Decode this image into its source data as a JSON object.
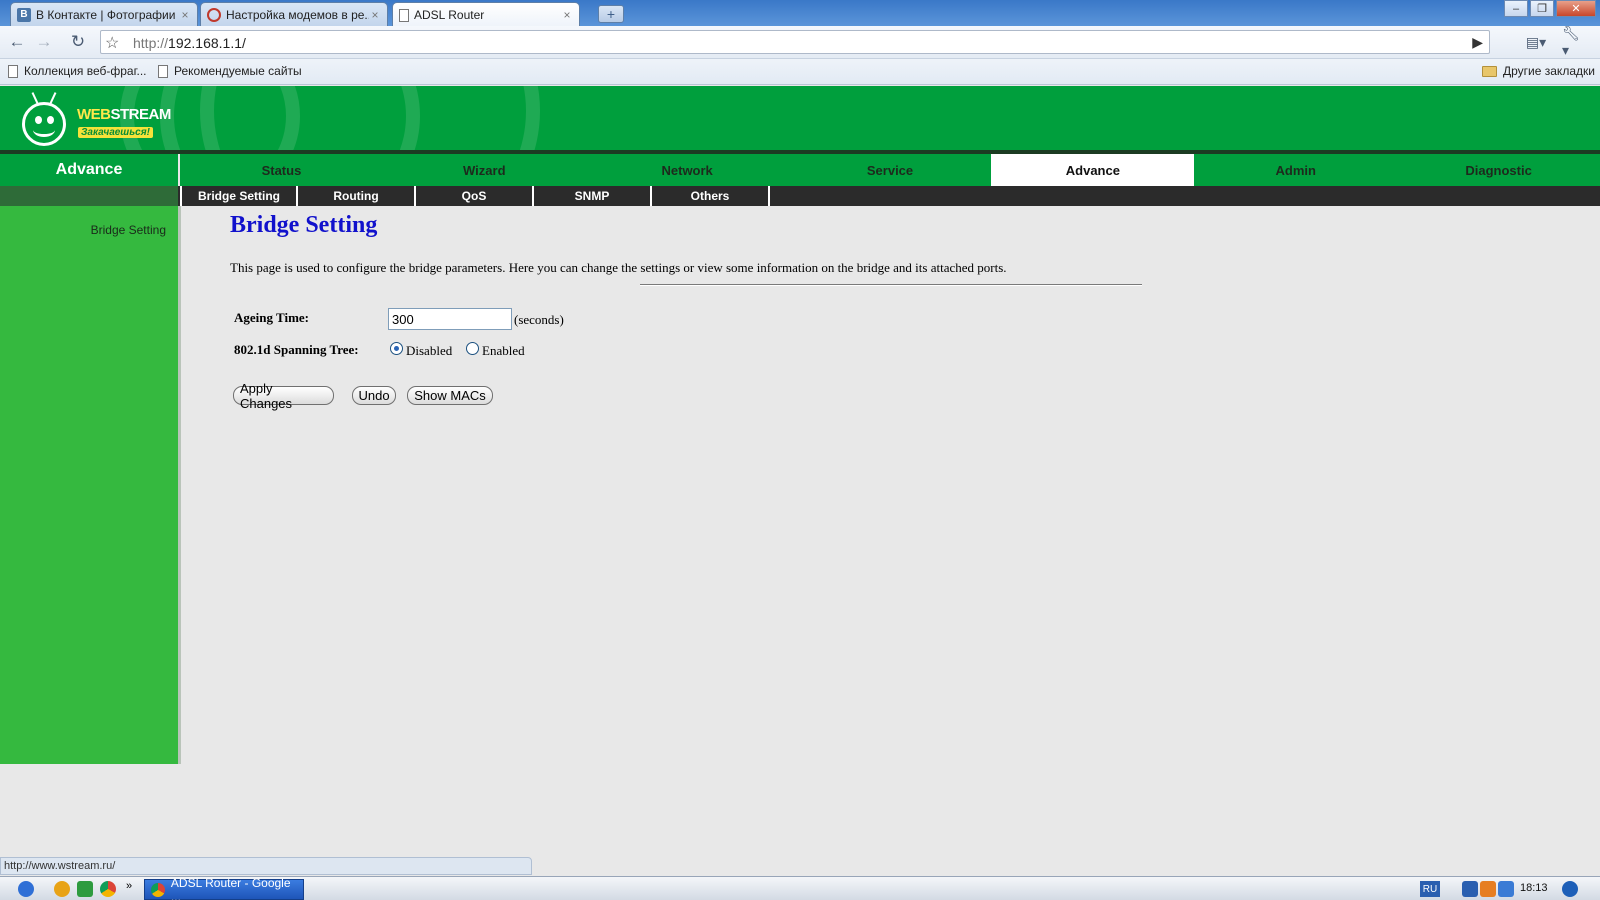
{
  "browser": {
    "tabs": [
      {
        "label": "В Контакте | Фотографии",
        "icon": "vk-icon",
        "active": false
      },
      {
        "label": "Настройка модемов в ре...",
        "icon": "site-favicon",
        "active": false
      },
      {
        "label": "ADSL Router",
        "icon": "page-icon",
        "active": true
      }
    ],
    "close_glyph": "×",
    "new_tab_glyph": "+",
    "address": {
      "scheme": "http://",
      "host": "192.168.1.1/"
    },
    "bookmarks": [
      "Коллекция веб-фраг...",
      "Рекомендуемые сайты"
    ],
    "other_bookmarks": "Другие закладки"
  },
  "router": {
    "brand": {
      "web": "WEB",
      "stream": "STREAM",
      "slogan": "Закачаешься!"
    },
    "section_title": "Advance",
    "main_nav": [
      {
        "label": "Status",
        "active": false
      },
      {
        "label": "Wizard",
        "active": false
      },
      {
        "label": "Network",
        "active": false
      },
      {
        "label": "Service",
        "active": false
      },
      {
        "label": "Advance",
        "active": true
      },
      {
        "label": "Admin",
        "active": false
      },
      {
        "label": "Diagnostic",
        "active": false
      }
    ],
    "sub_nav": [
      "Bridge Setting",
      "Routing",
      "QoS",
      "SNMP",
      "Others"
    ],
    "sidebar_link": "Bridge Setting",
    "page": {
      "title": "Bridge Setting",
      "description": "This page is used to configure the bridge parameters. Here you can change the settings or view some information on the bridge and its attached ports.",
      "ageing_label": "Ageing Time:",
      "ageing_value": "300",
      "ageing_unit": "(seconds)",
      "stp_label": "802.1d Spanning Tree:",
      "stp_options": [
        {
          "label": "Disabled",
          "checked": true
        },
        {
          "label": "Enabled",
          "checked": false
        }
      ],
      "buttons": [
        "Apply Changes",
        "Undo",
        "Show MACs"
      ]
    }
  },
  "status_url": "http://www.wstream.ru/",
  "taskbar": {
    "task_label": "ADSL Router - Google ...",
    "lang": "RU",
    "clock": "18:13"
  },
  "colors": {
    "header_green": "#009f3d",
    "sidebar_green": "#35b93f",
    "title_blue": "#1111cc"
  }
}
